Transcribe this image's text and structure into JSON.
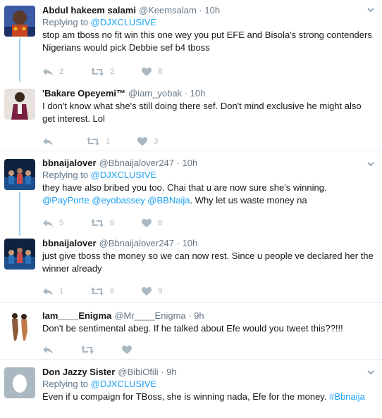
{
  "replying_prefix": "Replying to",
  "tweets": [
    {
      "name": "Abdul hakeem salami",
      "handle": "@Keemsalam",
      "time": "10h",
      "replying_to": "@DJXCLUSIVE",
      "text": "stop am tboss no fit win this one wey you put EFE and Bisola's strong contenders Nigerians would pick Debbie sef b4 tboss",
      "reply_count": "2",
      "retweet_count": "2",
      "like_count": "8",
      "avatar_color": "#3b2a22"
    },
    {
      "name": "'Bakare Opeyemi™",
      "handle": "@iam_yobak",
      "time": "10h",
      "text": "I don't know what she's still doing there sef. Don't mind exclusive he might also get interest. Lol",
      "reply_count": "",
      "retweet_count": "1",
      "like_count": "3",
      "avatar_color": "#6a1e3a"
    },
    {
      "name": "bbnaijalover",
      "handle": "@Bbnaijalover247",
      "time": "10h",
      "replying_to": "@DJXCLUSIVE",
      "text_plain": "they have also bribed you too. Chai that u are now sure she's winning.",
      "mentions": [
        "@PayPorte",
        "@eyobassey",
        "@BBNaija"
      ],
      "text_tail": ". Why let us waste money na",
      "reply_count": "5",
      "retweet_count": "6",
      "like_count": "8",
      "avatar_color": "#1c3a63"
    },
    {
      "name": "bbnaijalover",
      "handle": "@Bbnaijalover247",
      "time": "10h",
      "text": "just give tboss the money so we can now rest. Since u people ve declared her the winner already",
      "reply_count": "1",
      "retweet_count": "6",
      "like_count": "9",
      "avatar_color": "#1c3a63"
    },
    {
      "name": "Iam____Enigma",
      "handle": "@Mr____Enigma",
      "time": "9h",
      "text": "Don't be sentimental abeg. If he talked about Efe would you tweet this??!!!",
      "reply_count": "",
      "retweet_count": "",
      "like_count": "",
      "avatar_color": "#ffffff"
    },
    {
      "name": "Don Jazzy Sister",
      "handle": "@BibiOfili",
      "time": "9h",
      "replying_to": "@DJXCLUSIVE",
      "text_plain": "Even if u compaign for TBoss, she is winning nada, Efe for the money.",
      "hashtag": "#Bbnaija",
      "avatar_color": "#aab8c2"
    }
  ],
  "colors": {
    "link": "#1da1f2",
    "muted": "#657786",
    "icon": "#aab8c2",
    "thread_line": "#a3d4f2"
  }
}
